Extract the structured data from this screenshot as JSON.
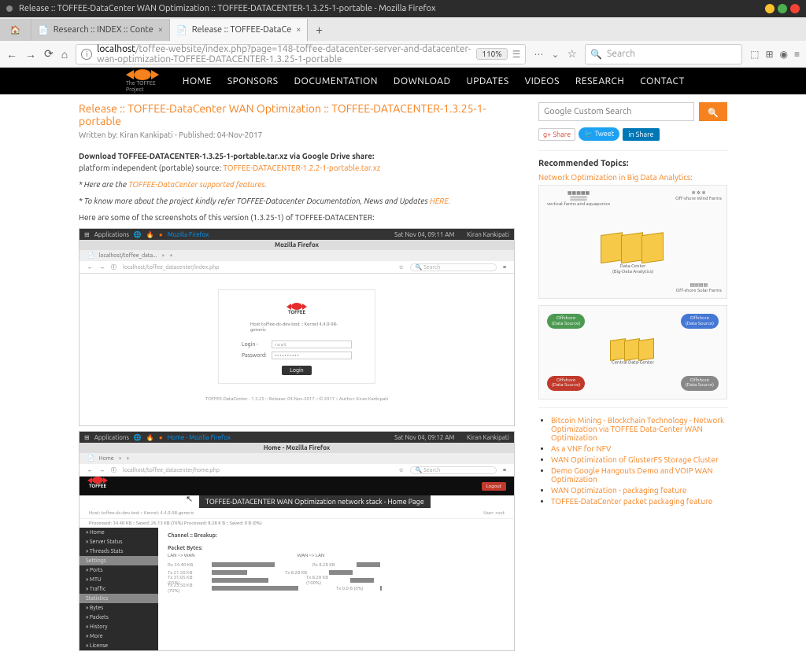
{
  "desktop": {
    "window_title": "Release :: TOFFEE-DataCenter WAN Optimization :: TOFFEE-DATACENTER-1.3.25-1-portable - Mozilla Firefox"
  },
  "tabs": {
    "pinned": "Home",
    "items": [
      {
        "label": "Research :: INDEX :: Conte"
      },
      {
        "label": "Release :: TOFFEE-DataCe"
      }
    ],
    "active_index": 1
  },
  "urlbar": {
    "host": "localhost",
    "path": "/toffee-website/index.php?page=148-toffee-datacenter-server-and-datacenter-wan-optimization-TOFFEE-DATACENTER-1.3.25-1-portable",
    "zoom": "110%",
    "search_placeholder": "Search"
  },
  "site_nav": [
    "HOME",
    "SPONSORS",
    "DOCUMENTATION",
    "DOWNLOAD",
    "UPDATES",
    "VIDEOS",
    "RESEARCH",
    "CONTACT"
  ],
  "logo_text": "The TOFFEE Project",
  "article": {
    "title": "Release :: TOFFEE-DataCenter WAN Optimization :: TOFFEE-DATACENTER-1.3.25-1-portable",
    "byline": "Written by: Kiran Kankipati - Published: 04-Nov-2017",
    "download_bold": "Download TOFFEE-DATACENTER-1.3.25-1-portable.tar.xz via Google Drive share:",
    "download_label": "platform independent (portable) source:",
    "download_link": "TOFFEE-DATACENTER-1.2.2-1-portable.tar.xz",
    "features_pre": "* Here are the ",
    "features_link": "TOFFEE-DataCenter supported features.",
    "docs_pre": "* To know more about the project kindly refer TOFFEE-Datacenter Documentation, News and Updates ",
    "docs_link": "HERE.",
    "screens_intro": "Here are some of the screenshots of this version (1.3.25-1) of TOFFEE-DATACENTER:"
  },
  "shot1": {
    "topbar_left": "Applications",
    "topbar_date": "Sat Nov 04, 09:11 AM",
    "topbar_user": "Kiran Kankipati",
    "ff_title": "Mozilla Firefox",
    "tab": "localhost/toffee_data...",
    "url": "localhost/toffee_datacenter/index.php",
    "search_ph": "Search",
    "logo": "TOFFEE",
    "host_line": "Host toffee-dc-dev-test :: Kernel 4.4.0-98-generic",
    "login_label": "Login -",
    "login_val": "root",
    "pass_label": "Password:",
    "pass_val": "••••••••••",
    "btn": "Login",
    "footer": "TOFFEE-DataCenter - 1.3.25 :: Release: 04-Nov-2017 :: © 2017 :: Author: Kiran Kankipati"
  },
  "shot2": {
    "topbar_date": "Sat Nov 04, 09:12 AM",
    "topbar_user": "Kiran Kankipati",
    "ff_title": "Home - Mozilla Firefox",
    "tab": "Home",
    "url": "localhost/toffee_datacenter/home.php",
    "logout": "Logout",
    "cursor_tooltip": "TOFFEE-DATACENTER WAN Optimization network stack - Home Page",
    "sub_left": "Host: toffee-dc-dev-test :: Kernel: 4.4.0-98-generic",
    "sub_right": "User: root",
    "stats_line": "Processed: 34.40 KB :: Saved: 26.13 KB (76%)    Processed: 8.28 K B :: Saved: 0 B (0%)",
    "side": [
      "» Home",
      "» Server Status",
      "» Threads Stats",
      "Settings",
      "» Ports",
      "» MTU",
      "» Traffic",
      "Statistics",
      "» Bytes",
      "» Packets",
      "» History",
      "» More",
      "» License"
    ],
    "section1": "Channel :: Breakup:",
    "section2": "Packet Bytes:",
    "col1": "LAN => WAN",
    "col2": "WAN => LAN",
    "rows": [
      {
        "l": "Rx 34.40 KB",
        "w1": 80,
        "l2": "Rx 8.28 KB",
        "w2": 30
      },
      {
        "l": "Tx 21.50 KB",
        "w1": 45,
        "l2": "Tx 8.28 KB",
        "w2": 30
      },
      {
        "l": "Tx 31.05 KB (95%)",
        "w1": 72,
        "l2": "Tx 8.28 KB (100%)",
        "w2": 30
      },
      {
        "l": "Tx 23.50 KB (70%)",
        "w1": 110,
        "l2": "Tx 0.0 B (0%)",
        "w2": 2
      }
    ]
  },
  "sidebar": {
    "search_ph": "Google Custom Search",
    "share": "Share",
    "tweet": "Tweet",
    "lin": "Share",
    "rec_h": "Recommended Topics:",
    "topic1": "Network Optimization in Big Data Analytics:",
    "diag1": {
      "label1": "vertical-farms and aquaponics",
      "label2": "Off-shore Wind Farms",
      "dc": "Data-Center\n(Big-Data Analytics)",
      "solar": "Off-shore Solar Farms"
    },
    "diag2": {
      "c1": "Offshore\n(Data Source)",
      "c2": "Offshore\n(Data Source)",
      "center": "Central Data-Center",
      "c3": "Offshore\n(Data Source)",
      "c4": "Offshore\n(Data Source)"
    },
    "related": [
      "Bitcoin Mining - Blockchain Technology - Network Optimization via TOFFEE Data-Center WAN Optimization",
      "As a VNF for NFV",
      "WAN Optimization of GlusterFS Storage Cluster",
      "Demo Google Hangouts Demo and VOIP WAN Optimization",
      "WAN Optimization - packaging feature",
      "TOFFEE-DataCenter packet packaging feature"
    ]
  }
}
